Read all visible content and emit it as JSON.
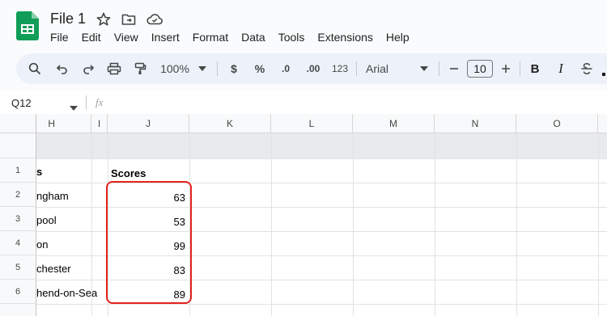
{
  "app": {
    "file_title": "File 1",
    "menu": [
      "File",
      "Edit",
      "View",
      "Insert",
      "Format",
      "Data",
      "Tools",
      "Extensions",
      "Help"
    ]
  },
  "toolbar": {
    "zoom": "100%",
    "currency": "$",
    "percent": "%",
    "dec_decrease": ".0",
    "dec_increase": ".00",
    "number_format": "123",
    "font": "Arial",
    "font_size": "10",
    "bold": "B",
    "italic": "I"
  },
  "formula_bar": {
    "name_box": "Q12",
    "fx": "fx"
  },
  "grid": {
    "columns": [
      "H",
      "I",
      "J",
      "K",
      "L",
      "M",
      "N",
      "O"
    ],
    "row_numbers": [
      "1",
      "2",
      "3",
      "4",
      "5",
      "6",
      ""
    ],
    "cells": {
      "h1": "s",
      "j1": "Scores",
      "h2": "ngham",
      "h3": "pool",
      "h4": "on",
      "h5": "chester",
      "h6": "hend-on-Sea",
      "j2": "63",
      "j3": "53",
      "j4": "99",
      "j5": "83",
      "j6": "89"
    }
  },
  "colors": {
    "highlight_border": "#e3231b",
    "sheets_green": "#0f9d58",
    "toolbar_bg": "#edf2fa"
  }
}
